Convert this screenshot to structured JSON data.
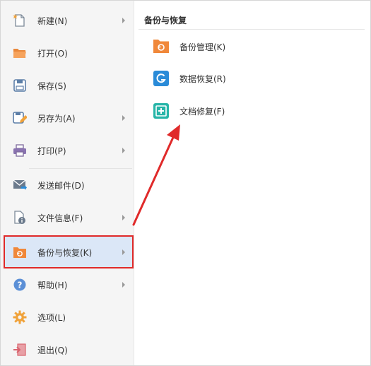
{
  "menu": {
    "items": [
      {
        "label": "新建(N)",
        "icon": "new-file-icon",
        "has_submenu": true
      },
      {
        "label": "打开(O)",
        "icon": "folder-open-icon",
        "has_submenu": false
      },
      {
        "label": "保存(S)",
        "icon": "save-icon",
        "has_submenu": false
      },
      {
        "label": "另存为(A)",
        "icon": "save-as-icon",
        "has_submenu": true
      },
      {
        "label": "打印(P)",
        "icon": "printer-icon",
        "has_submenu": true
      },
      {
        "label": "发送邮件(D)",
        "icon": "mail-icon",
        "has_submenu": false
      },
      {
        "label": "文件信息(F)",
        "icon": "file-info-icon",
        "has_submenu": true
      },
      {
        "label": "备份与恢复(K)",
        "icon": "backup-folder-icon",
        "has_submenu": true,
        "active": true
      },
      {
        "label": "帮助(H)",
        "icon": "help-icon",
        "has_submenu": true
      },
      {
        "label": "选项(L)",
        "icon": "gear-icon",
        "has_submenu": false
      },
      {
        "label": "退出(Q)",
        "icon": "exit-icon",
        "has_submenu": false
      }
    ]
  },
  "submenu": {
    "title": "备份与恢复",
    "items": [
      {
        "label": "备份管理(K)",
        "icon": "backup-folder-icon"
      },
      {
        "label": "数据恢复(R)",
        "icon": "data-recovery-icon"
      },
      {
        "label": "文档修复(F)",
        "icon": "document-repair-icon"
      }
    ]
  },
  "colors": {
    "menu_bg": "#f5f5f5",
    "active_bg": "#dbe7f7",
    "highlight": "#e02a2a",
    "orange": "#f0883a",
    "blue": "#2a8bd8",
    "teal": "#27b5a8",
    "gray_icon": "#6b7a8c"
  }
}
